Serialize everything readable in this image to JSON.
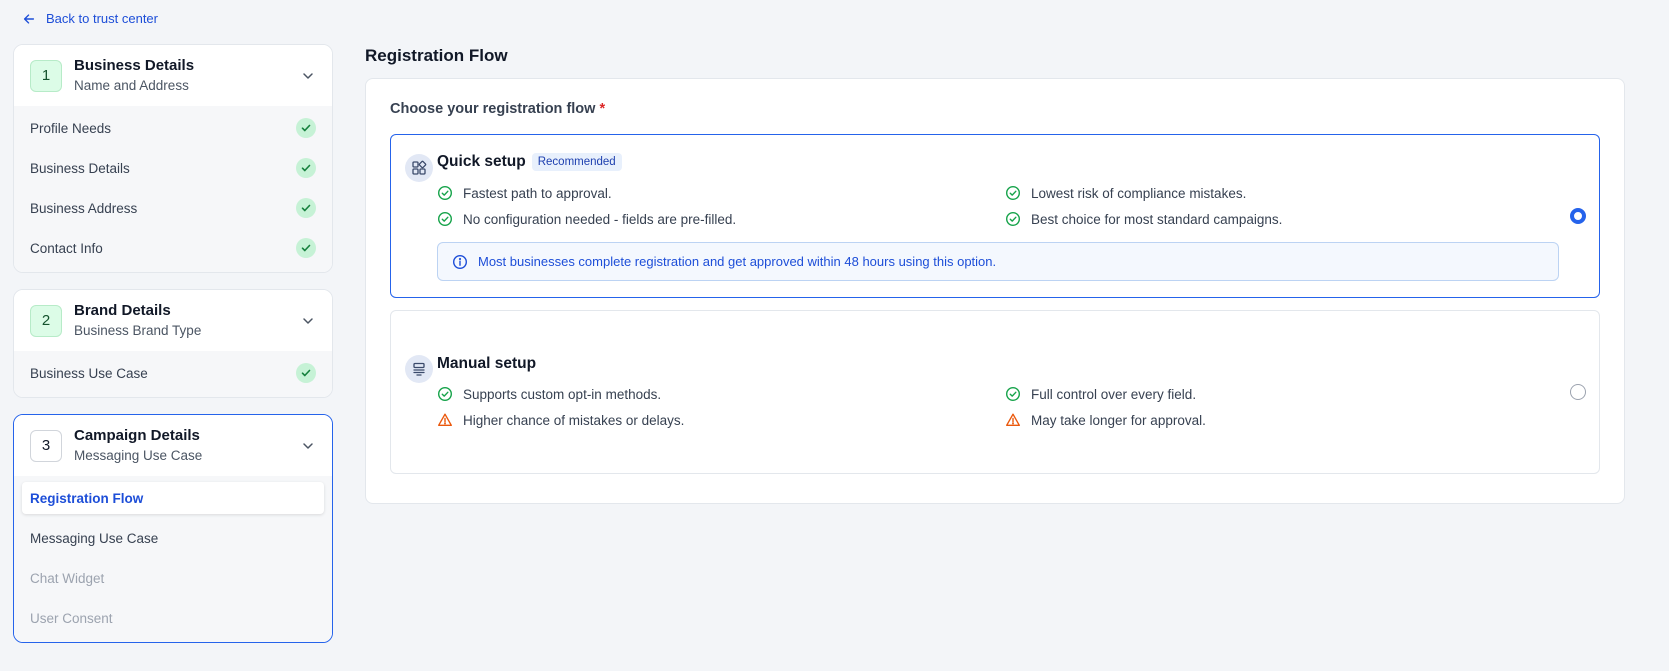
{
  "back_link": {
    "label": "Back to trust center",
    "icon": "arrow-left-icon"
  },
  "sidebar": {
    "steps": [
      {
        "number": "1",
        "title": "Business Details",
        "subtitle": "Name and Address",
        "items": [
          {
            "label": "Profile Needs",
            "status": "done"
          },
          {
            "label": "Business Details",
            "status": "done"
          },
          {
            "label": "Business Address",
            "status": "done"
          },
          {
            "label": "Contact Info",
            "status": "done"
          }
        ]
      },
      {
        "number": "2",
        "title": "Brand Details",
        "subtitle": "Business Brand Type",
        "items": [
          {
            "label": "Business Use Case",
            "status": "done"
          }
        ]
      },
      {
        "number": "3",
        "title": "Campaign Details",
        "subtitle": "Messaging Use Case",
        "items": [
          {
            "label": "Registration Flow",
            "status": "current"
          },
          {
            "label": "Messaging Use Case",
            "status": "pending"
          },
          {
            "label": "Chat Widget",
            "status": "disabled"
          },
          {
            "label": "User Consent",
            "status": "disabled"
          }
        ]
      }
    ]
  },
  "main": {
    "title": "Registration Flow",
    "question": "Choose your registration flow",
    "required_mark": "*",
    "options": [
      {
        "title": "Quick setup",
        "badge": "Recommended",
        "selected": true,
        "icon": "grid-layout-icon",
        "features": [
          {
            "text": "Fastest path to approval.",
            "kind": "check"
          },
          {
            "text": "Lowest risk of compliance mistakes.",
            "kind": "check"
          },
          {
            "text": "No configuration needed - fields are pre-filled.",
            "kind": "check"
          },
          {
            "text": "Best choice for most standard campaigns.",
            "kind": "check"
          }
        ],
        "info": "Most businesses complete registration and get approved within 48 hours using this option."
      },
      {
        "title": "Manual setup",
        "selected": false,
        "icon": "form-settings-icon",
        "features": [
          {
            "text": "Supports custom opt-in methods.",
            "kind": "check"
          },
          {
            "text": "Full control over every field.",
            "kind": "check"
          },
          {
            "text": "Higher chance of mistakes or delays.",
            "kind": "warning"
          },
          {
            "text": "May take longer for approval.",
            "kind": "warning"
          }
        ]
      }
    ]
  },
  "colors": {
    "accent": "#2563eb",
    "success": "#16a34a",
    "warning": "#ea580c",
    "required": "#dc2626"
  }
}
